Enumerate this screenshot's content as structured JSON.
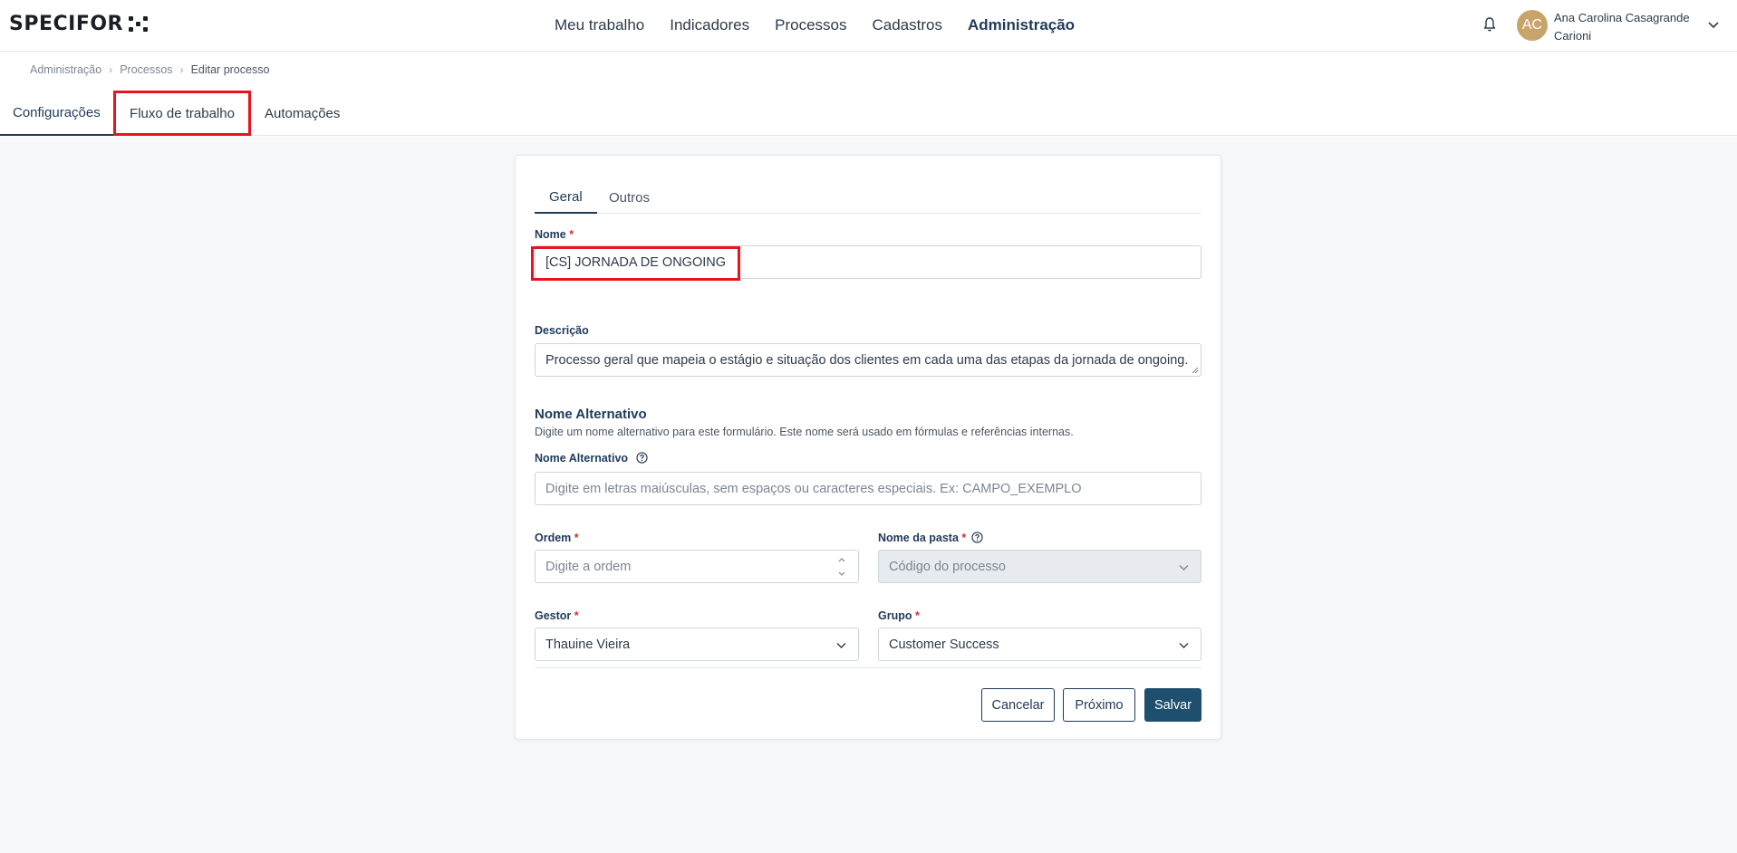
{
  "app": {
    "logo_text": "SPECIFOR"
  },
  "nav": {
    "items": [
      {
        "label": "Meu trabalho"
      },
      {
        "label": "Indicadores"
      },
      {
        "label": "Processos"
      },
      {
        "label": "Cadastros"
      },
      {
        "label": "Administração"
      }
    ]
  },
  "user": {
    "initials": "AC",
    "name_line1": "Ana Carolina Casagrande",
    "name_line2": "Carioni"
  },
  "breadcrumb": {
    "items": [
      "Administração",
      "Processos",
      "Editar processo"
    ]
  },
  "page_tabs": [
    {
      "label": "Configurações"
    },
    {
      "label": "Fluxo de trabalho"
    },
    {
      "label": "Automações"
    }
  ],
  "form": {
    "tabs": [
      {
        "label": "Geral"
      },
      {
        "label": "Outros"
      }
    ],
    "nome": {
      "label": "Nome",
      "required": "*",
      "value": "[CS]  JORNADA DE ONGOING"
    },
    "descricao": {
      "label": "Descrição",
      "value": "Processo geral que mapeia o estágio e situação dos clientes em cada uma das etapas da jornada de ongoing."
    },
    "alt_section": {
      "title": "Nome Alternativo",
      "description": "Digite um nome alternativo para este formulário. Este nome será usado em fórmulas e referências internas."
    },
    "nome_alternativo": {
      "label": "Nome Alternativo",
      "placeholder": "Digite em letras maiúsculas, sem espaços ou caracteres especiais. Ex: CAMPO_EXEMPLO"
    },
    "ordem": {
      "label": "Ordem",
      "required": "*",
      "placeholder": "Digite a ordem"
    },
    "nome_pasta": {
      "label": "Nome da pasta",
      "required": "*",
      "value": "Código do processo"
    },
    "gestor": {
      "label": "Gestor",
      "required": "*",
      "value": "Thauine Vieira"
    },
    "grupo": {
      "label": "Grupo",
      "required": "*",
      "value": "Customer Success"
    },
    "buttons": {
      "cancel": "Cancelar",
      "next": "Próximo",
      "save": "Salvar"
    }
  },
  "colors": {
    "primary": "#1f4f6e",
    "accent_text": "#1f3a5a",
    "highlight": "#e8131c",
    "required": "#d32f2f"
  }
}
